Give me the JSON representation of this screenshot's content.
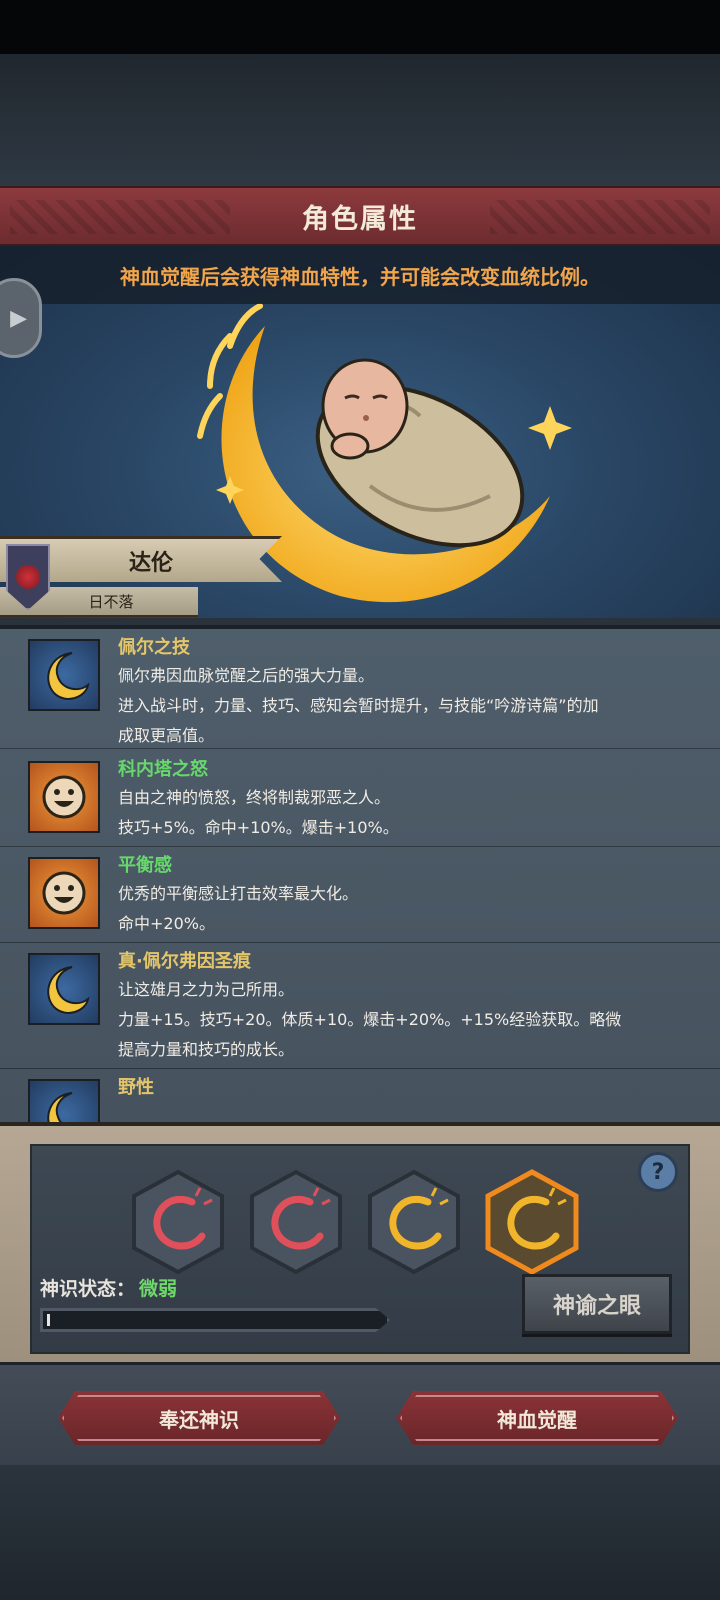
{
  "header": {
    "title": "角色属性"
  },
  "hero": {
    "info": "神血觉醒后会获得神血特性，并可能会改变血统比例。",
    "side_button_icon": "play-arrow-icon",
    "character_name": "达伦",
    "character_title": "日不落"
  },
  "traits": [
    {
      "icon": "crescent-moon-icon",
      "name": "佩尔之技",
      "name_color": "#e4c66a",
      "desc": [
        "佩尔弗因血脉觉醒之后的强大力量。",
        "进入战斗时，力量、技巧、感知会暂时提升，与技能“吟游诗篇”的加",
        "成取更高值。"
      ]
    },
    {
      "icon": "smiling-sun-icon",
      "name": "科内塔之怒",
      "name_color": "#67d86b",
      "desc": [
        "自由之神的愤怒，终将制裁邪恶之人。",
        "技巧+5%。命中+10%。爆击+10%。"
      ]
    },
    {
      "icon": "smiling-sun-icon",
      "name": "平衡感",
      "name_color": "#67d86b",
      "desc": [
        "优秀的平衡感让打击效率最大化。",
        "命中+20%。"
      ]
    },
    {
      "icon": "crescent-moon-icon",
      "name": "真·佩尔弗因圣痕",
      "name_color": "#e4c66a",
      "desc": [
        "让这雄月之力为己所用。",
        "力量+15。技巧+20。体质+10。爆击+20%。+15%经验获取。略微",
        "提高力量和技巧的成长。"
      ]
    },
    {
      "icon": "crescent-moon-icon",
      "name": "野性",
      "name_color": "#e4c66a",
      "desc": []
    }
  ],
  "divine": {
    "slots": [
      {
        "icon": "red-swirl-icon",
        "color": "#e0505a"
      },
      {
        "icon": "red-swirl-icon",
        "color": "#e0505a"
      },
      {
        "icon": "gold-swirl-icon",
        "color": "#f0b52a"
      },
      {
        "icon": "gold-swirl-icon",
        "color": "#f0b52a",
        "selected": true
      }
    ],
    "help_label": "?",
    "status_label": "神识状态：",
    "status_value": "微弱",
    "status_progress": 0.01,
    "eye_button": "神谕之眼"
  },
  "actions": {
    "return_label": "奉还神识",
    "awaken_label": "神血觉醒"
  }
}
